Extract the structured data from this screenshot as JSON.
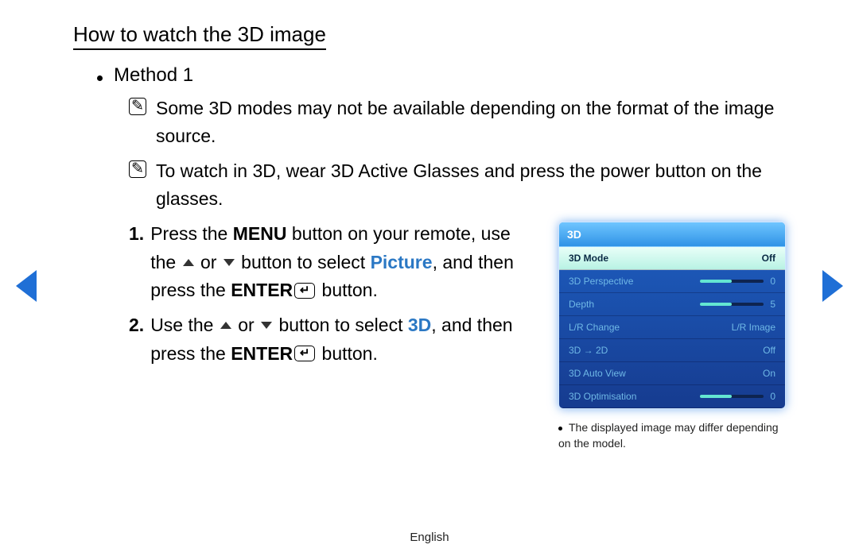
{
  "title": "How to watch the 3D image",
  "method_label": "Method 1",
  "notes": [
    "Some 3D modes may not be available depending on the format of the image source.",
    "To watch in 3D, wear 3D Active Glasses and press the power button on the glasses."
  ],
  "steps": {
    "s1num": "1.",
    "s1_a": "Press the ",
    "s1_menu": "MENU",
    "s1_b": " button on your remote, use the ",
    "s1_or": " or ",
    "s1_c": " button to select ",
    "s1_picture": "Picture",
    "s1_d": ", and then press the ",
    "s1_enter": "ENTER",
    "s1_e": " button.",
    "s2num": "2.",
    "s2_a": "Use the ",
    "s2_or": " or ",
    "s2_b": " button to select ",
    "s2_3d": "3D",
    "s2_c": ", and then press the ",
    "s2_enter": "ENTER",
    "s2_d": " button."
  },
  "card": {
    "header": "3D",
    "rows": [
      {
        "label": "3D Mode",
        "value": "Off",
        "selected": true
      },
      {
        "label": "3D Perspective",
        "value": "0",
        "slider": 50
      },
      {
        "label": "Depth",
        "value": "5",
        "slider": 50
      },
      {
        "label": "L/R Change",
        "value": "L/R Image"
      },
      {
        "label": "3D → 2D",
        "value": "Off"
      },
      {
        "label": "3D Auto View",
        "value": "On"
      },
      {
        "label": "3D Optimisation",
        "value": "0",
        "slider": 50
      }
    ]
  },
  "caption": "The displayed image may differ depending on the model.",
  "footer": "English",
  "icons": {
    "enter_glyph": "↵",
    "note_glyph": "✎"
  }
}
